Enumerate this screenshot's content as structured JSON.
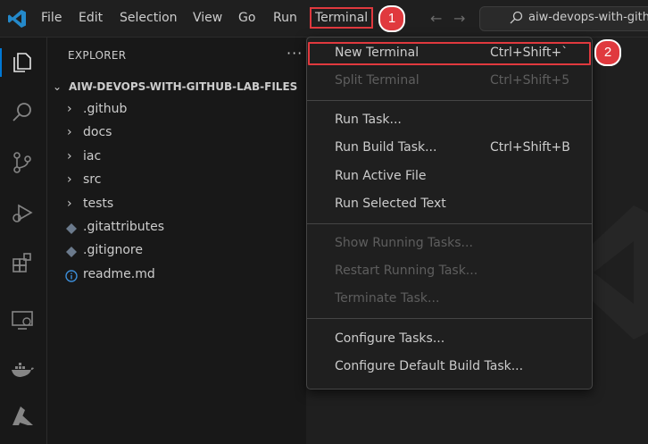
{
  "menubar": {
    "items": [
      "File",
      "Edit",
      "Selection",
      "View",
      "Go",
      "Run",
      "Terminal"
    ],
    "active": "Terminal"
  },
  "search": {
    "text": "aiw-devops-with-gith"
  },
  "explorer": {
    "title": "EXPLORER",
    "more": "···",
    "folder": "AIW-DEVOPS-WITH-GITHUB-LAB-FILES",
    "items": [
      {
        "name": ".github",
        "kind": "folder"
      },
      {
        "name": "docs",
        "kind": "folder"
      },
      {
        "name": "iac",
        "kind": "folder"
      },
      {
        "name": "src",
        "kind": "folder"
      },
      {
        "name": "tests",
        "kind": "folder"
      },
      {
        "name": ".gitattributes",
        "kind": "git-file"
      },
      {
        "name": ".gitignore",
        "kind": "git-file"
      },
      {
        "name": "readme.md",
        "kind": "info-file"
      }
    ]
  },
  "terminal_menu": {
    "items": [
      {
        "label": "New Terminal",
        "shortcut": "Ctrl+Shift+`",
        "disabled": false
      },
      {
        "label": "Split Terminal",
        "shortcut": "Ctrl+Shift+5",
        "disabled": true
      },
      {
        "label": "Run Task...",
        "shortcut": "",
        "disabled": false
      },
      {
        "label": "Run Build Task...",
        "shortcut": "Ctrl+Shift+B",
        "disabled": false
      },
      {
        "label": "Run Active File",
        "shortcut": "",
        "disabled": false
      },
      {
        "label": "Run Selected Text",
        "shortcut": "",
        "disabled": false
      },
      {
        "label": "Show Running Tasks...",
        "shortcut": "",
        "disabled": true
      },
      {
        "label": "Restart Running Task...",
        "shortcut": "",
        "disabled": true
      },
      {
        "label": "Terminate Task...",
        "shortcut": "",
        "disabled": true
      },
      {
        "label": "Configure Tasks...",
        "shortcut": "",
        "disabled": false
      },
      {
        "label": "Configure Default Build Task...",
        "shortcut": "",
        "disabled": false
      }
    ]
  },
  "callouts": [
    "1",
    "2"
  ],
  "colors": {
    "accent": "#0078d4",
    "callout": "#e0393e",
    "background": "#1f1f1f"
  }
}
